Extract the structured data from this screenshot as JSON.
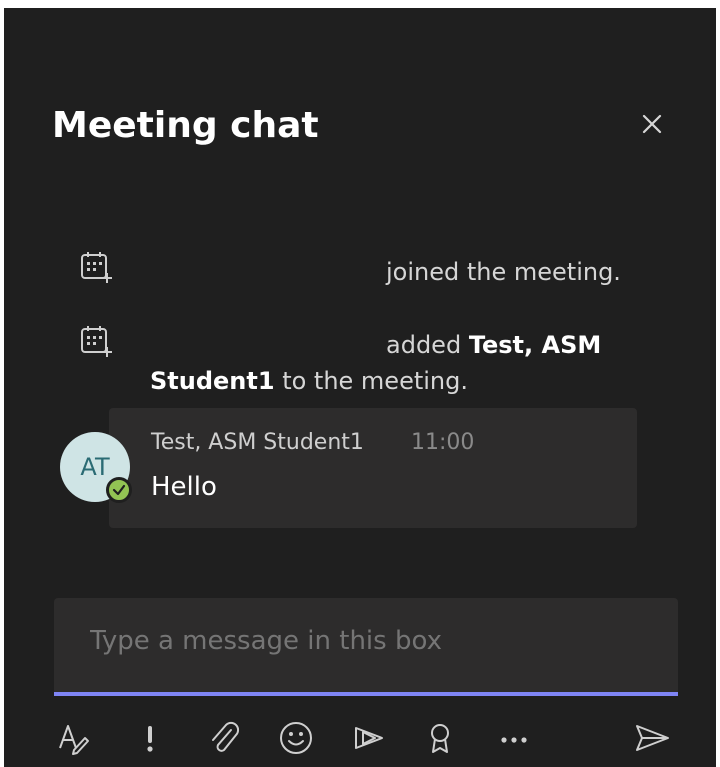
{
  "header": {
    "title": "Meeting chat",
    "close_icon": "close-icon"
  },
  "events": [
    {
      "icon": "calendar-add-icon",
      "text": "joined the meeting."
    },
    {
      "icon": "calendar-add-icon",
      "prefix": "added ",
      "bold": "Test, ASM",
      "bold2": "Student1",
      "suffix": " to the meeting."
    }
  ],
  "message": {
    "avatar_initials": "AT",
    "presence": "available",
    "sender": "Test, ASM Student1",
    "time": "11:00",
    "text": "Hello"
  },
  "composer": {
    "placeholder": "Type a message in this box"
  },
  "toolbar": [
    "format-icon",
    "important-icon",
    "attach-icon",
    "emoji-icon",
    "stream-icon",
    "praise-icon",
    "more-icon",
    "send-icon"
  ],
  "colors": {
    "background": "#1f1f1f",
    "bubble": "#2d2c2c",
    "accent": "#7f85f5",
    "presence_available": "#92c353",
    "avatar_bg": "#cfe4e5"
  }
}
